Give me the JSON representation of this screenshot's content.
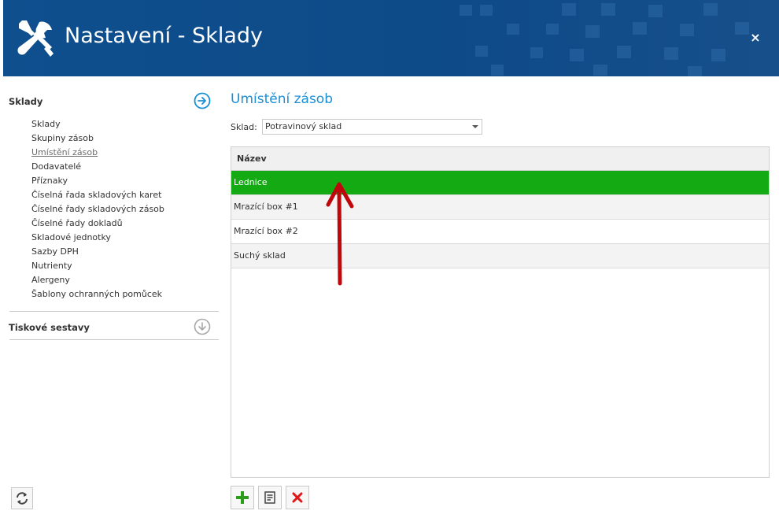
{
  "window": {
    "title": "Nastavení - Sklady",
    "close_label": "×"
  },
  "sidebar": {
    "section1": {
      "title": "Sklady",
      "icon": "arrow-right-circle-icon"
    },
    "items": [
      {
        "label": "Sklady"
      },
      {
        "label": "Skupiny zásob"
      },
      {
        "label": "Umístění zásob",
        "active": true
      },
      {
        "label": "Dodavatelé"
      },
      {
        "label": "Příznaky"
      },
      {
        "label": "Číselná řada skladových karet"
      },
      {
        "label": "Číselné řady skladových zásob"
      },
      {
        "label": "Číselné řady dokladů"
      },
      {
        "label": "Skladové jednotky"
      },
      {
        "label": "Sazby DPH"
      },
      {
        "label": "Nutrienty"
      },
      {
        "label": "Alergeny"
      },
      {
        "label": "Šablony ochranných pomůcek"
      }
    ],
    "section2": {
      "title": "Tiskové sestavy",
      "icon": "arrow-down-circle-icon"
    },
    "refresh_icon": "refresh-icon"
  },
  "main": {
    "title": "Umístění zásob",
    "sklad_label": "Sklad:",
    "sklad_value": "Potravinový sklad",
    "grid": {
      "column": "Název",
      "rows": [
        "Lednice",
        "Mrazící box #1",
        "Mrazící box #2",
        "Suchý sklad"
      ],
      "selected_index": 0
    },
    "toolbar": {
      "add_icon": "plus-icon",
      "edit_icon": "edit-document-icon",
      "delete_icon": "delete-x-icon"
    }
  },
  "colors": {
    "header": "#0f4f8e",
    "accent": "#1a8fd6",
    "selected_row": "#13aa13",
    "annotation_arrow": "#c0080c"
  }
}
